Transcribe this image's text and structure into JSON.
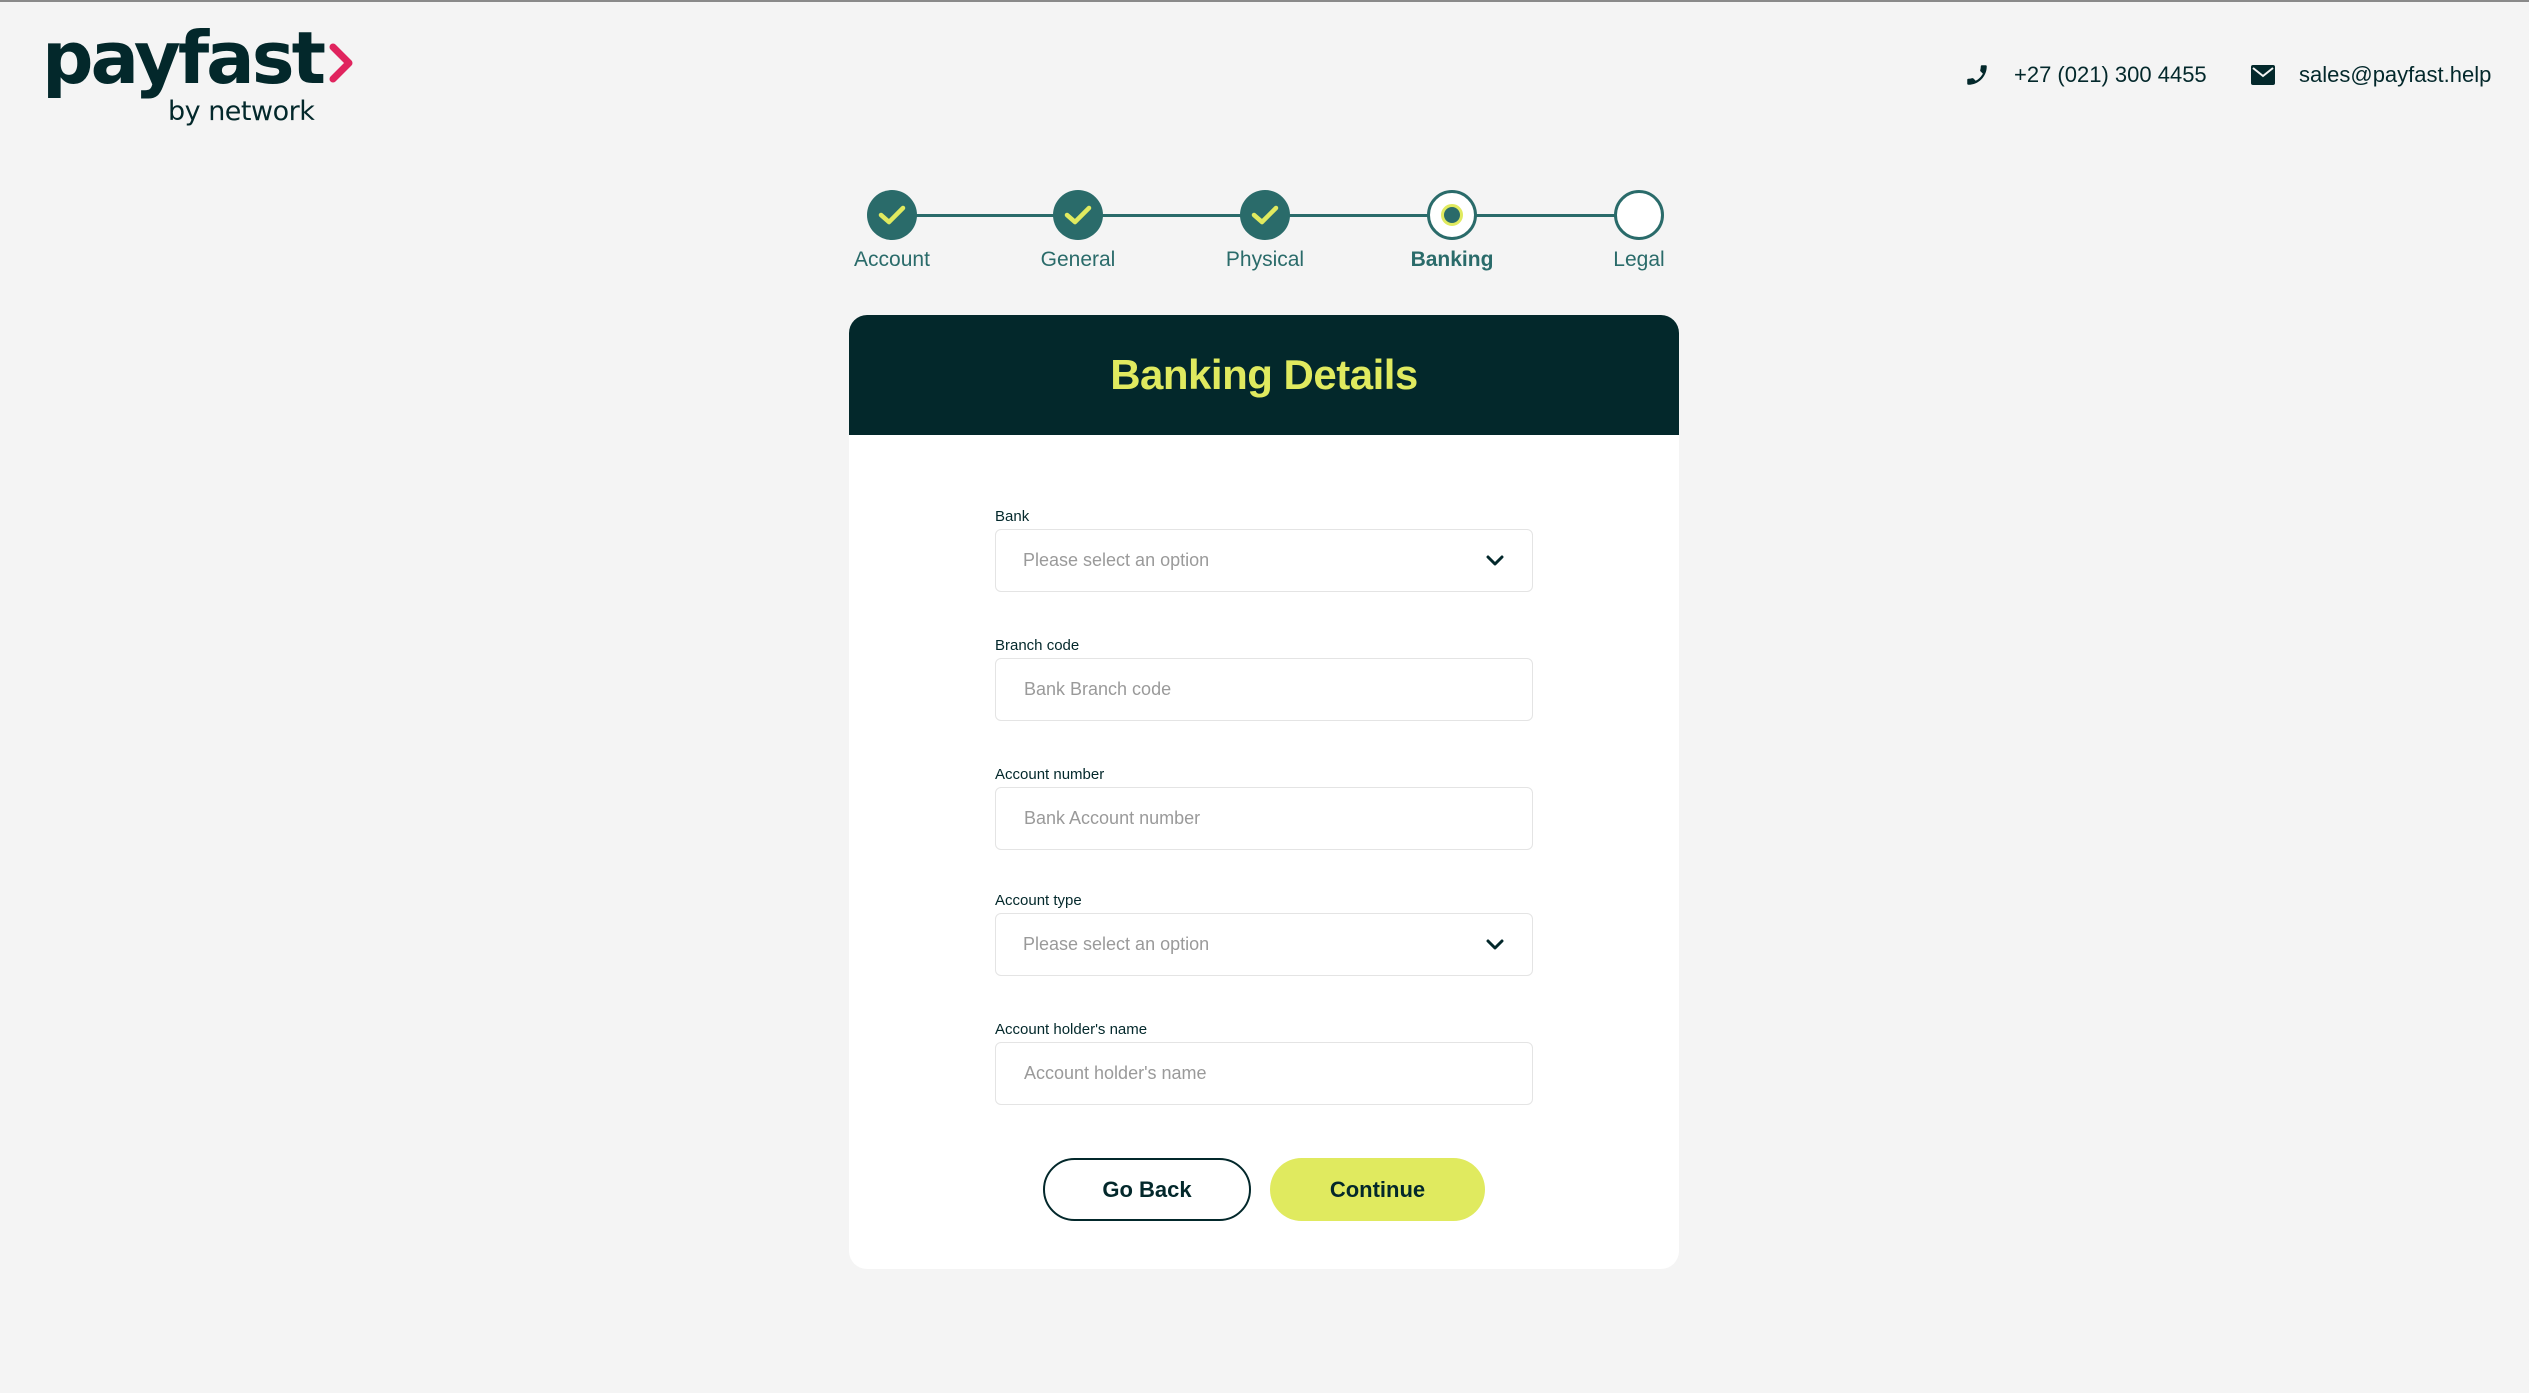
{
  "header": {
    "logo_text": "payfast",
    "logo_sub": "by network",
    "phone": "+27 (021) 300 4455",
    "email": "sales@payfast.help"
  },
  "stepper": {
    "steps": [
      {
        "label": "Account",
        "state": "done"
      },
      {
        "label": "General",
        "state": "done"
      },
      {
        "label": "Physical",
        "state": "done"
      },
      {
        "label": "Banking",
        "state": "current"
      },
      {
        "label": "Legal",
        "state": "todo"
      }
    ]
  },
  "card": {
    "title": "Banking Details"
  },
  "form": {
    "bank": {
      "label": "Bank",
      "placeholder": "Please select an option"
    },
    "branch_code": {
      "label": "Branch code",
      "placeholder": "Bank Branch code"
    },
    "account_number": {
      "label": "Account number",
      "placeholder": "Bank Account number"
    },
    "account_type": {
      "label": "Account type",
      "placeholder": "Please select an option"
    },
    "holder_name": {
      "label": "Account holder's name",
      "placeholder": "Account holder's name"
    }
  },
  "buttons": {
    "back": "Go Back",
    "continue": "Continue"
  },
  "colors": {
    "brand_dark": "#03282b",
    "brand_teal": "#2a6b6a",
    "accent_lime": "#e0ea5f",
    "logo_chevron": "#e0245e"
  }
}
